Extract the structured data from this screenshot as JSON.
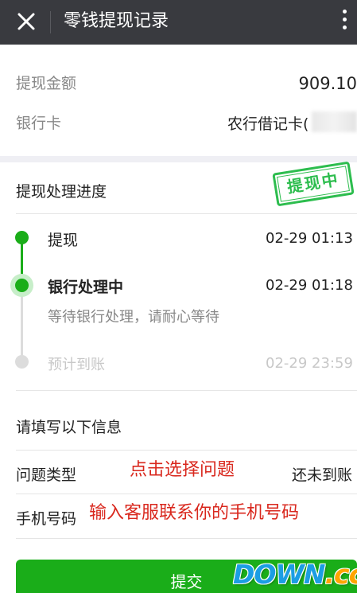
{
  "header": {
    "title": "零钱提现记录",
    "close_icon": "close-icon",
    "more_icon": "more-vertical-icon"
  },
  "summary": {
    "amount_label": "提现金额",
    "amount_value": "909.10",
    "bank_label": "银行卡",
    "bank_value": "农行借记卡("
  },
  "progress": {
    "title": "提现处理进度",
    "stamp": "提现中",
    "steps": [
      {
        "label": "提现",
        "time": "02-29 01:13",
        "state": "done"
      },
      {
        "label": "银行处理中",
        "time": "02-29 01:18",
        "state": "current",
        "desc": "等待银行处理，请耐心等待"
      },
      {
        "label": "预计到账",
        "time": "02-29 23:59",
        "state": "pending"
      }
    ]
  },
  "form": {
    "title": "请填写以下信息",
    "fields": [
      {
        "label": "问题类型",
        "value": "还未到账",
        "annotation": "点击选择问题"
      },
      {
        "label": "手机号码",
        "annotation": "输入客服联系你的手机号码"
      }
    ],
    "submit_label": "提交"
  },
  "watermark": {
    "main": "DOWN",
    "suffix": ".cc"
  },
  "colors": {
    "titlebar": "#393a3f",
    "accent_green": "#1aad19",
    "annotation_red": "#d9281e",
    "pending_gray": "#dcdcdc"
  }
}
